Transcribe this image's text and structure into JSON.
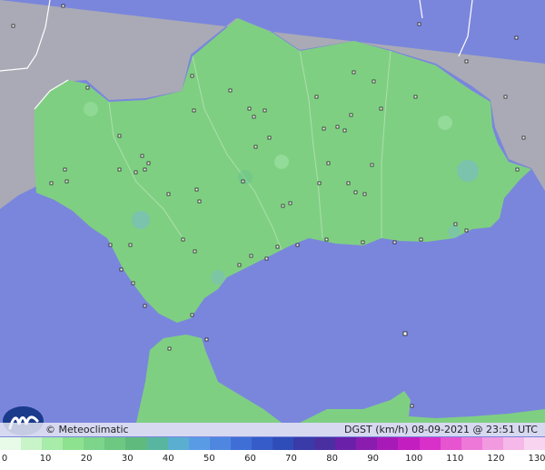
{
  "attribution": "© Meteoclimatic",
  "caption": "DGST (km/h)   08-09-2021 @ 23:51 UTC",
  "logo_icon": "meteoclimatic-logo-icon",
  "colors": {
    "sea": "#7a86dc",
    "land_other": "#a9aab5",
    "land_main": "#7fcf82",
    "border": "#ffffff"
  },
  "legend": {
    "ticks": [
      "0",
      "10",
      "20",
      "30",
      "40",
      "50",
      "60",
      "70",
      "80",
      "90",
      "100",
      "110",
      "120",
      "130"
    ],
    "colors": [
      "#e8fbe8",
      "#c9f3c9",
      "#a8ecaa",
      "#8ce28f",
      "#7cd58a",
      "#6dc882",
      "#5fbb7d",
      "#58b6a0",
      "#5aaed0",
      "#5a9be6",
      "#4f87e0",
      "#3f6fd6",
      "#355cc8",
      "#2f4db8",
      "#3a3aa8",
      "#4a2fa0",
      "#6a20a8",
      "#8a1cb0",
      "#a81ab8",
      "#c21ec0",
      "#d830c8",
      "#e654d0",
      "#ee78d8",
      "#f29ae0",
      "#f5b8e8",
      "#f8d4f0"
    ]
  }
}
